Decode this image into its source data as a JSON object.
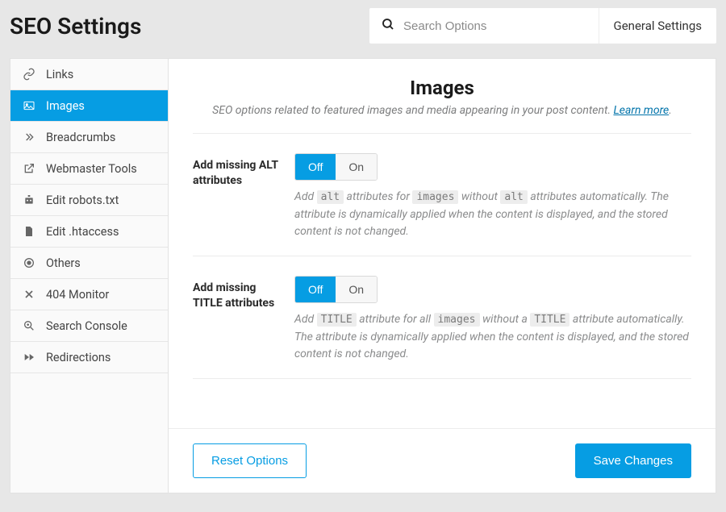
{
  "header": {
    "title": "SEO Settings",
    "search_placeholder": "Search Options",
    "right_tab": "General Settings"
  },
  "sidebar": {
    "items": [
      {
        "label": "Links",
        "icon": "links-icon"
      },
      {
        "label": "Images",
        "icon": "images-icon",
        "active": true
      },
      {
        "label": "Breadcrumbs",
        "icon": "chevrons-icon"
      },
      {
        "label": "Webmaster Tools",
        "icon": "external-icon"
      },
      {
        "label": "Edit robots.txt",
        "icon": "robot-icon"
      },
      {
        "label": "Edit .htaccess",
        "icon": "file-icon"
      },
      {
        "label": "Others",
        "icon": "target-icon"
      },
      {
        "label": "404 Monitor",
        "icon": "x-icon"
      },
      {
        "label": "Search Console",
        "icon": "zoom-icon"
      },
      {
        "label": "Redirections",
        "icon": "forward-icon"
      }
    ]
  },
  "panel": {
    "title": "Images",
    "subtitle": "SEO options related to featured images and media appearing in your post content. ",
    "learn_more": "Learn more",
    "fields": [
      {
        "label": "Add missing ALT attributes",
        "off": "Off",
        "on": "On",
        "selected": "off",
        "desc_pre": "Add ",
        "desc_c1": "alt",
        "desc_mid1": " attributes for ",
        "desc_c2": "images",
        "desc_mid2": " without ",
        "desc_c3": "alt",
        "desc_tail": " attributes automatically. The attribute is dynamically applied when the content is displayed, and the stored content is not changed."
      },
      {
        "label": "Add missing TITLE attributes",
        "off": "Off",
        "on": "On",
        "selected": "off",
        "desc_pre": "Add ",
        "desc_c1": "TITLE",
        "desc_mid1": " attribute for all ",
        "desc_c2": "images",
        "desc_mid2": " without a ",
        "desc_c3": "TITLE",
        "desc_tail": " attribute automatically. The attribute is dynamically applied when the content is displayed, and the stored content is not changed."
      }
    ]
  },
  "footer": {
    "reset": "Reset Options",
    "save": "Save Changes"
  }
}
